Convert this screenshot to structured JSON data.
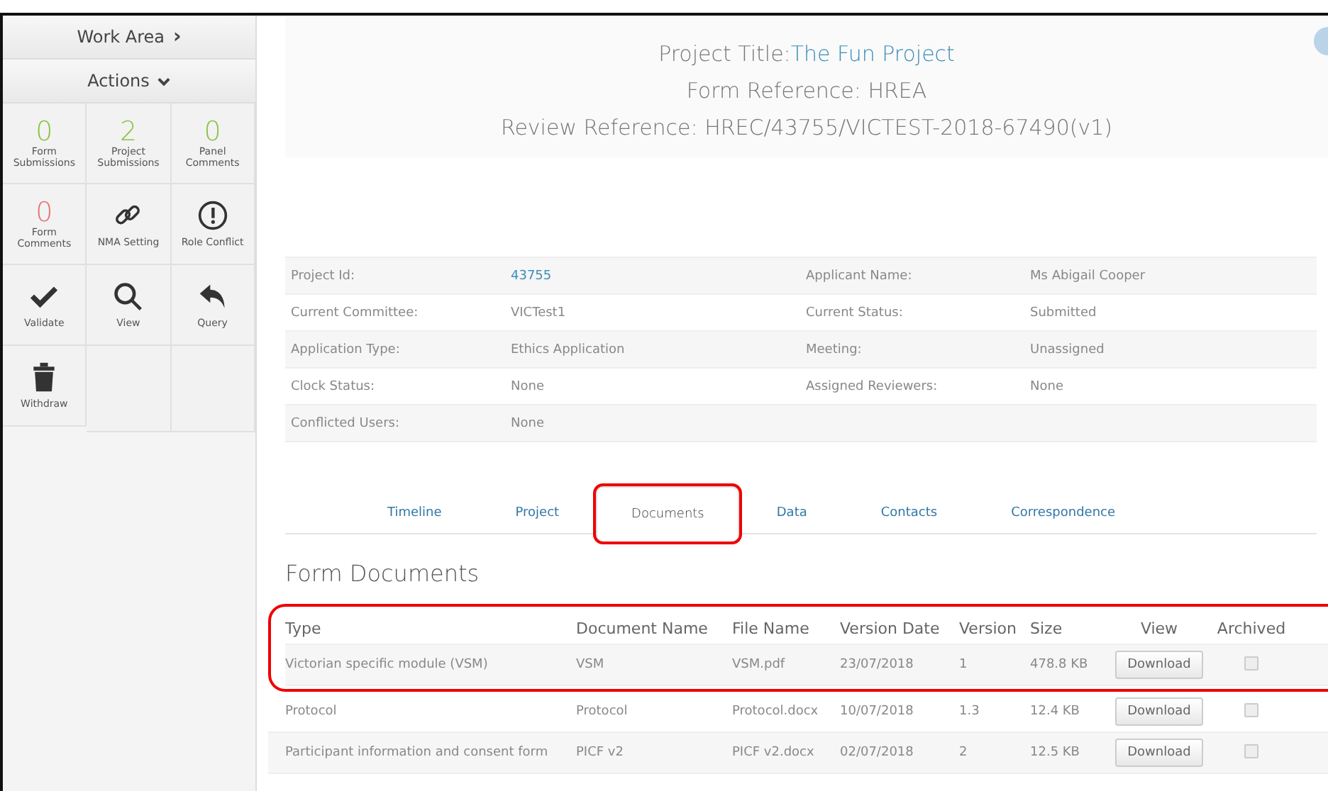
{
  "sidebar": {
    "work_area": {
      "label": "Work Area",
      "caret": "›"
    },
    "actions": {
      "label": "Actions",
      "expanded": true
    },
    "tiles": [
      {
        "kind": "count",
        "value": "0",
        "label": "Form Submissions",
        "color": "#8bc34a"
      },
      {
        "kind": "count",
        "value": "2",
        "label": "Project Submissions",
        "color": "#8bc34a"
      },
      {
        "kind": "count",
        "value": "0",
        "label": "Panel Comments",
        "color": "#8bc34a"
      },
      {
        "kind": "count",
        "value": "0",
        "label": "Form Comments",
        "color": "#e57373"
      },
      {
        "kind": "link",
        "label": "NMA Setting"
      },
      {
        "kind": "alert",
        "label": "Role Conflict"
      },
      {
        "kind": "check",
        "label": "Validate"
      },
      {
        "kind": "search",
        "label": "View"
      },
      {
        "kind": "reply",
        "label": "Query"
      },
      {
        "kind": "trash",
        "label": "Withdraw"
      }
    ]
  },
  "header": {
    "project_title_label": "Project Title:",
    "project_title": "The Fun Project",
    "form_reference": "Form Reference: HREA",
    "review_reference": "Review Reference: HREC/43755/VICTEST-2018-67490(v1)"
  },
  "details": [
    {
      "label": "Project Id:",
      "value": "43755",
      "link": true,
      "label2": "Applicant Name:",
      "value2": "Ms Abigail Cooper"
    },
    {
      "label": "Current Committee:",
      "value": "VICTest1",
      "link": false,
      "label2": "Current Status:",
      "value2": "Submitted"
    },
    {
      "label": "Application Type:",
      "value": "Ethics Application",
      "link": false,
      "label2": "Meeting:",
      "value2": "Unassigned"
    },
    {
      "label": "Clock Status:",
      "value": "None",
      "link": false,
      "label2": "Assigned Reviewers:",
      "value2": "None"
    },
    {
      "label": "Conflicted Users:",
      "value": "None",
      "link": false
    }
  ],
  "tabs": [
    {
      "label": "Timeline",
      "selected": false,
      "highlighted": false
    },
    {
      "label": "Project",
      "selected": false,
      "highlighted": false
    },
    {
      "label": "Documents",
      "selected": true,
      "highlighted": true
    },
    {
      "label": "Data",
      "selected": false,
      "highlighted": false
    },
    {
      "label": "Contacts",
      "selected": false,
      "highlighted": false
    },
    {
      "label": "Correspondence",
      "selected": false,
      "highlighted": false
    }
  ],
  "section_title": "Form Documents",
  "table": {
    "columns": [
      "Type",
      "Document Name",
      "File Name",
      "Version Date",
      "Version",
      "Size",
      "View",
      "Archived"
    ],
    "rows": [
      {
        "cells": [
          "Victorian specific module (VSM)",
          "VSM",
          "VSM.pdf",
          "23/07/2018",
          "1",
          "478.8 KB"
        ],
        "button": "Download",
        "archived": false,
        "highlighted": true
      },
      {
        "cells": [
          "Protocol",
          "Protocol",
          "Protocol.docx",
          "10/07/2018",
          "1.3",
          "12.4 KB"
        ],
        "button": "Download",
        "archived": false,
        "highlighted": false
      },
      {
        "cells": [
          "Participant information and consent form",
          "PICF v2",
          "PICF v2.docx",
          "02/07/2018",
          "2",
          "12.5 KB"
        ],
        "button": "Download",
        "archived": false,
        "highlighted": false
      }
    ]
  }
}
